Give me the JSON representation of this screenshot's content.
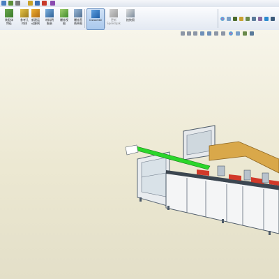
{
  "toolbar": {
    "buttons": [
      {
        "label": "装配体\n特征",
        "icon": "assembly-features-icon"
      },
      {
        "label": "参考几\n何体",
        "icon": "reference-geometry-icon"
      },
      {
        "label": "新建运\n动算例",
        "icon": "new-motion-study-icon"
      },
      {
        "label": "材料明\n细表",
        "icon": "bill-of-materials-icon"
      },
      {
        "label": "爆炸视\n图",
        "icon": "exploded-view-icon"
      },
      {
        "label": "爆炸直\n线草图",
        "icon": "explode-line-sketch-icon"
      },
      {
        "label": "Instant3D",
        "icon": "instant3d-icon"
      },
      {
        "label": "更新\nSpeedpak",
        "icon": "speedpak-icon"
      },
      {
        "label": "拍快照",
        "icon": "snapshot-icon"
      }
    ],
    "active_button": "Instant3D"
  },
  "colors": {
    "accent_green": "#2bd62b",
    "wood": "#d9a84a",
    "frame": "#5d6a78",
    "red": "#d23a2a"
  }
}
